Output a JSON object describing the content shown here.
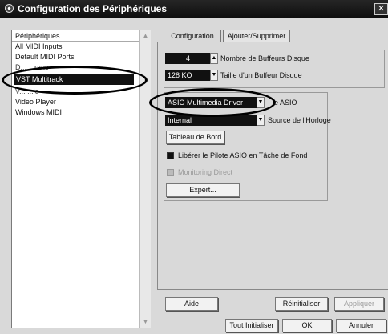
{
  "window": {
    "title": "Configuration des Périphériques",
    "close_glyph": "✕"
  },
  "device_list": {
    "header": "Périphériques",
    "items": [
      "All MIDI Inputs",
      "Default MIDI Ports",
      "D... ...ranc",
      "VST Multitrack",
      "V... ...le",
      "Video Player",
      "Windows MIDI"
    ],
    "selected": "VST Multitrack"
  },
  "tabs": [
    "Configuration",
    "Ajouter/Supprimer"
  ],
  "buffers": {
    "count_value": "4",
    "count_label": "Nombre de Buffeurs Disque",
    "size_value": "128 KO",
    "size_label": "Taille d'un Buffeur Disque"
  },
  "asio": {
    "driver_value": "ASIO Multimedia Driver",
    "driver_label": "le ASIO",
    "clock_value": "Internal",
    "clock_label": "Source de l'Horloge",
    "control_panel_button": "Tableau de Bord",
    "background_checkbox_label": "Libérer le Pilote ASIO en Tâche de Fond",
    "monitoring_label": "Monitoring Direct",
    "expert_button": "Expert..."
  },
  "panel_buttons": {
    "help": "Aide",
    "reset": "Réinitialiser",
    "apply": "Appliquer"
  },
  "footer_buttons": {
    "reset_all": "Tout Initialiser",
    "ok": "OK",
    "cancel": "Annuler"
  },
  "icons": {
    "arrow_up": "▲",
    "arrow_down": "▼",
    "spin_up": "▲",
    "dropdown": "▼"
  }
}
